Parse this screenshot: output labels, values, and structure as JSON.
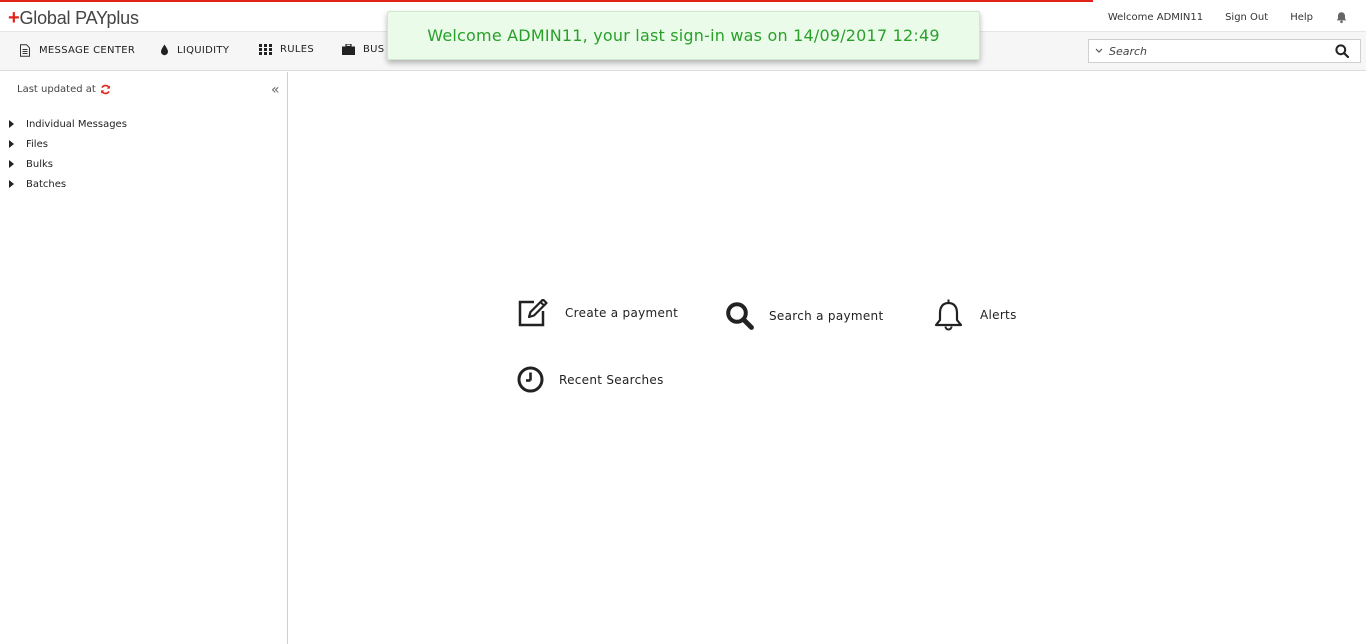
{
  "header": {
    "logo_plus": "+",
    "logo_text": "Global PAYplus",
    "welcome": "Welcome ADMIN11",
    "sign_out": "Sign Out",
    "help": "Help",
    "bell_icon": "bell-icon"
  },
  "nav": {
    "items": [
      {
        "label": "MESSAGE CENTER",
        "icon": "document-icon"
      },
      {
        "label": "LIQUIDITY",
        "icon": "drop-icon"
      },
      {
        "label": "RULES",
        "icon": "grid-icon"
      },
      {
        "label": "BUS",
        "icon": "briefcase-icon"
      }
    ]
  },
  "search": {
    "placeholder": "Search"
  },
  "toast": {
    "message": "Welcome ADMIN11, your last sign-in was on 14/09/2017 12:49"
  },
  "sidebar": {
    "last_updated": "Last updated at",
    "collapse": "«",
    "tree": [
      {
        "label": "Individual Messages"
      },
      {
        "label": "Files"
      },
      {
        "label": "Bulks"
      },
      {
        "label": "Batches"
      }
    ]
  },
  "main": {
    "actions": [
      {
        "label": "Create a payment",
        "icon": "edit-icon"
      },
      {
        "label": "Search a payment",
        "icon": "search-icon"
      },
      {
        "label": "Alerts",
        "icon": "bell-icon"
      },
      {
        "label": "Recent Searches",
        "icon": "clock-icon"
      }
    ]
  },
  "colors": {
    "accent_red": "#e2231a",
    "toast_text": "#2aa02a",
    "toast_bg": "#eafbea"
  }
}
